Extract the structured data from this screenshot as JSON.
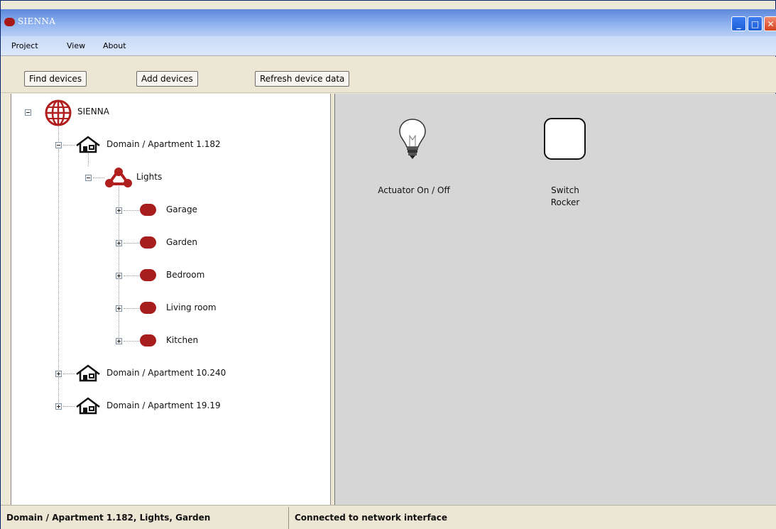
{
  "window": {
    "title": "SIENNA",
    "controls": {
      "minimize": "_",
      "maximize": "□",
      "close": "✕"
    }
  },
  "menu": {
    "items": [
      "Project",
      "View",
      "About"
    ]
  },
  "toolbar": {
    "find_devices": "Find devices",
    "add_devices": "Add devices",
    "refresh_device_data": "Refresh device data"
  },
  "tree": {
    "root": "SIENNA",
    "domain1": "Domain / Apartment 1.182",
    "lights": "Lights",
    "rooms": [
      "Garage",
      "Garden",
      "Bedroom",
      "Living room",
      "Kitchen"
    ],
    "domain2": "Domain / Apartment 10.240",
    "domain3": "Domain / Apartment 19.19"
  },
  "devices": {
    "actuator": "Actuator On / Off",
    "switch_line1": "Switch",
    "switch_line2": "Rocker"
  },
  "status": {
    "selection": "Domain / Apartment 1.182, Lights, Garden",
    "connection": "Connected to network interface"
  },
  "colors": {
    "accent_red": "#a81e1e",
    "titlebar_blue": "#6f97e3",
    "canvas_gray": "#d6d6d6"
  }
}
